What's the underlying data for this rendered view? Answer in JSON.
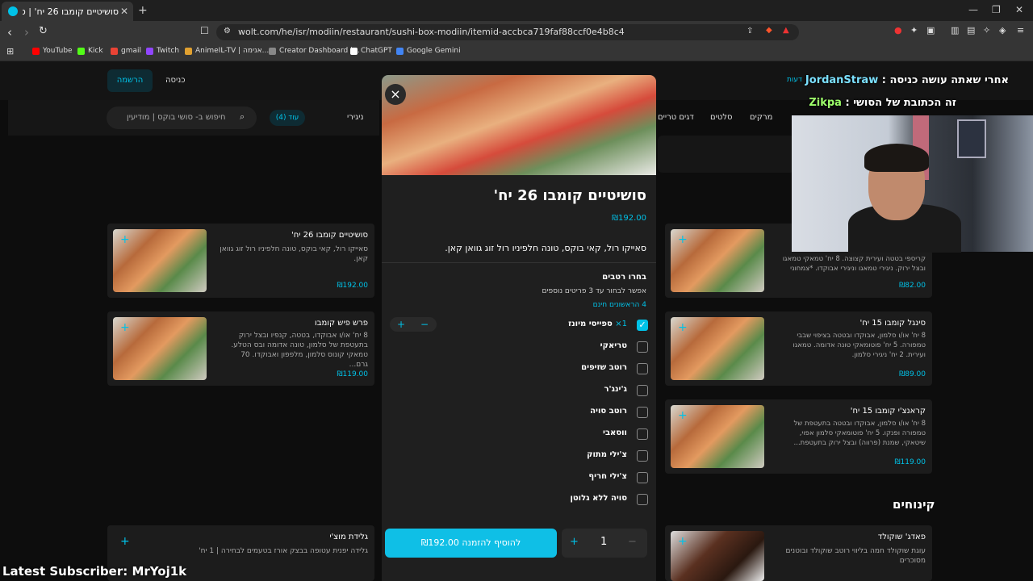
{
  "browser": {
    "tab_title": "סושיטיים קומבו 26 יח' | סושי בוקס",
    "new_tab": "+",
    "url": "wolt.com/he/isr/modiin/restaurant/sushi-box-modiin/itemid-accbca719faf88ccf0e4b8c4",
    "bookmarks": [
      "YouTube",
      "Kick",
      "gmail",
      "Twitch",
      "AnimeIL-TV | אנימה...",
      "Creator Dashboard |...",
      "ChatGPT",
      "Google Gemini"
    ],
    "bookmark_colors": [
      "#ff0000",
      "#53fc18",
      "#ea4335",
      "#9146ff",
      "#e0a030",
      "#888888",
      "#ffffff",
      "#4285f4"
    ]
  },
  "header": {
    "signup": "הרשמה",
    "login": "כניסה",
    "lang": "דעות",
    "search_placeholder": "חיפוש ב- סושי בוקס | מודיעין",
    "more": "עוד (4)",
    "nav": [
      "ניגירי",
      "דגים טריים",
      "סלטים",
      "מרקים"
    ]
  },
  "cards_left": [
    {
      "name": "סושיטיים קומבו 26 יח'",
      "desc": "סאייקו רול, קאי בוקס, טונה חלפיניו רול זוג גוואן קאן.",
      "price": "₪192.00"
    },
    {
      "name": "פרש פיש קומבו",
      "desc": "8 יח' או/ו אבוקדו, בטטה, קנפיו ובצל ירוק בתעטפת של סלמון, טונה אדומה ובס הטלע. טמאקי קונוס סלמון, מלפפון ואבוקדו. 70 גרם...",
      "price": "₪119.00"
    },
    {
      "name": "גלידת מוצ'י",
      "desc": "גלידה יפנית עטופה בבצק אורז בטעמים לבחירה | 1 יח'",
      "price": ""
    }
  ],
  "cards_right": [
    {
      "name": "",
      "desc": "קריספי בטטה ועירית קצוצה. 8 יח' טמאקי טמאגו ובצל ירוק. ניגירי טמאגו וניגירי אבוקדו. *צמחוני",
      "price": "₪82.00"
    },
    {
      "name": "סינגל קומבו 15 יח'",
      "desc": "8 יח' או/ו סלמון, אבוקדו ובטטה בציפוי שבבי טמפורה. 5 יח' פוטומאקי טונה אדומה. טמאגו ועירית. 2 יח' ניגירי סלמון.",
      "price": "₪89.00"
    },
    {
      "name": "קראנצ'י קומבו 15 יח'",
      "desc": "8 יח' או/ו סלמון, אבוקדו ובטטה בתעטפת של טמפורה ופנקו. 5 יח' פוטומאקי סלמון אפוי, שיטאקי, שמנת (פרווה) ובצל ירוק בתעטפת...",
      "price": "₪119.00"
    },
    {
      "name": "פאדג' שוקולד",
      "desc": "עוגת שוקולד חמה בליווי רוטב שוקולד ובוטנים מסוכרים",
      "price": ""
    }
  ],
  "section_desserts": "קינוחים",
  "modal": {
    "close": "×",
    "title": "סושיטיים קומבו 26 יח'",
    "price": "₪192.00",
    "desc": "סאייקו רול, קאי בוקס, טונה חלפיניו רול זוג גוואן קאן.",
    "group_title": "בחרו רטבים",
    "group_sub": "אפשר לבחור עד 3 פריטים נוספים",
    "group_free": "4 הראשונים חינם",
    "options": [
      {
        "label": "ספייסי מיונז",
        "qty": "1×",
        "checked": true
      },
      {
        "label": "טריאקי",
        "qty": "",
        "checked": false
      },
      {
        "label": "רוטב שזיפים",
        "qty": "",
        "checked": false
      },
      {
        "label": "ג'ינג'ר",
        "qty": "",
        "checked": false
      },
      {
        "label": "רוטב סויה",
        "qty": "",
        "checked": false
      },
      {
        "label": "ווסאבי",
        "qty": "",
        "checked": false
      },
      {
        "label": "צ'ילי מתוק",
        "qty": "",
        "checked": false
      },
      {
        "label": "צ'ילי חריף",
        "qty": "",
        "checked": false
      },
      {
        "label": "סויה ללא גלוטן",
        "qty": "",
        "checked": false
      }
    ],
    "stepper_minus": "−",
    "stepper_plus": "+",
    "add_button": "להוסיף להזמנה ₪192.00",
    "quantity": "1",
    "qty_minus": "−",
    "qty_plus": "+"
  },
  "stream": {
    "chat1_user": "JordanStraw",
    "chat1_text": "אחרי שאתה עושה כניסה :",
    "chat2_user": "Zikpa",
    "chat2_text": "זה הכתובת של הסושי :",
    "subscriber": "Latest Subscriber: MrYoj1k"
  }
}
